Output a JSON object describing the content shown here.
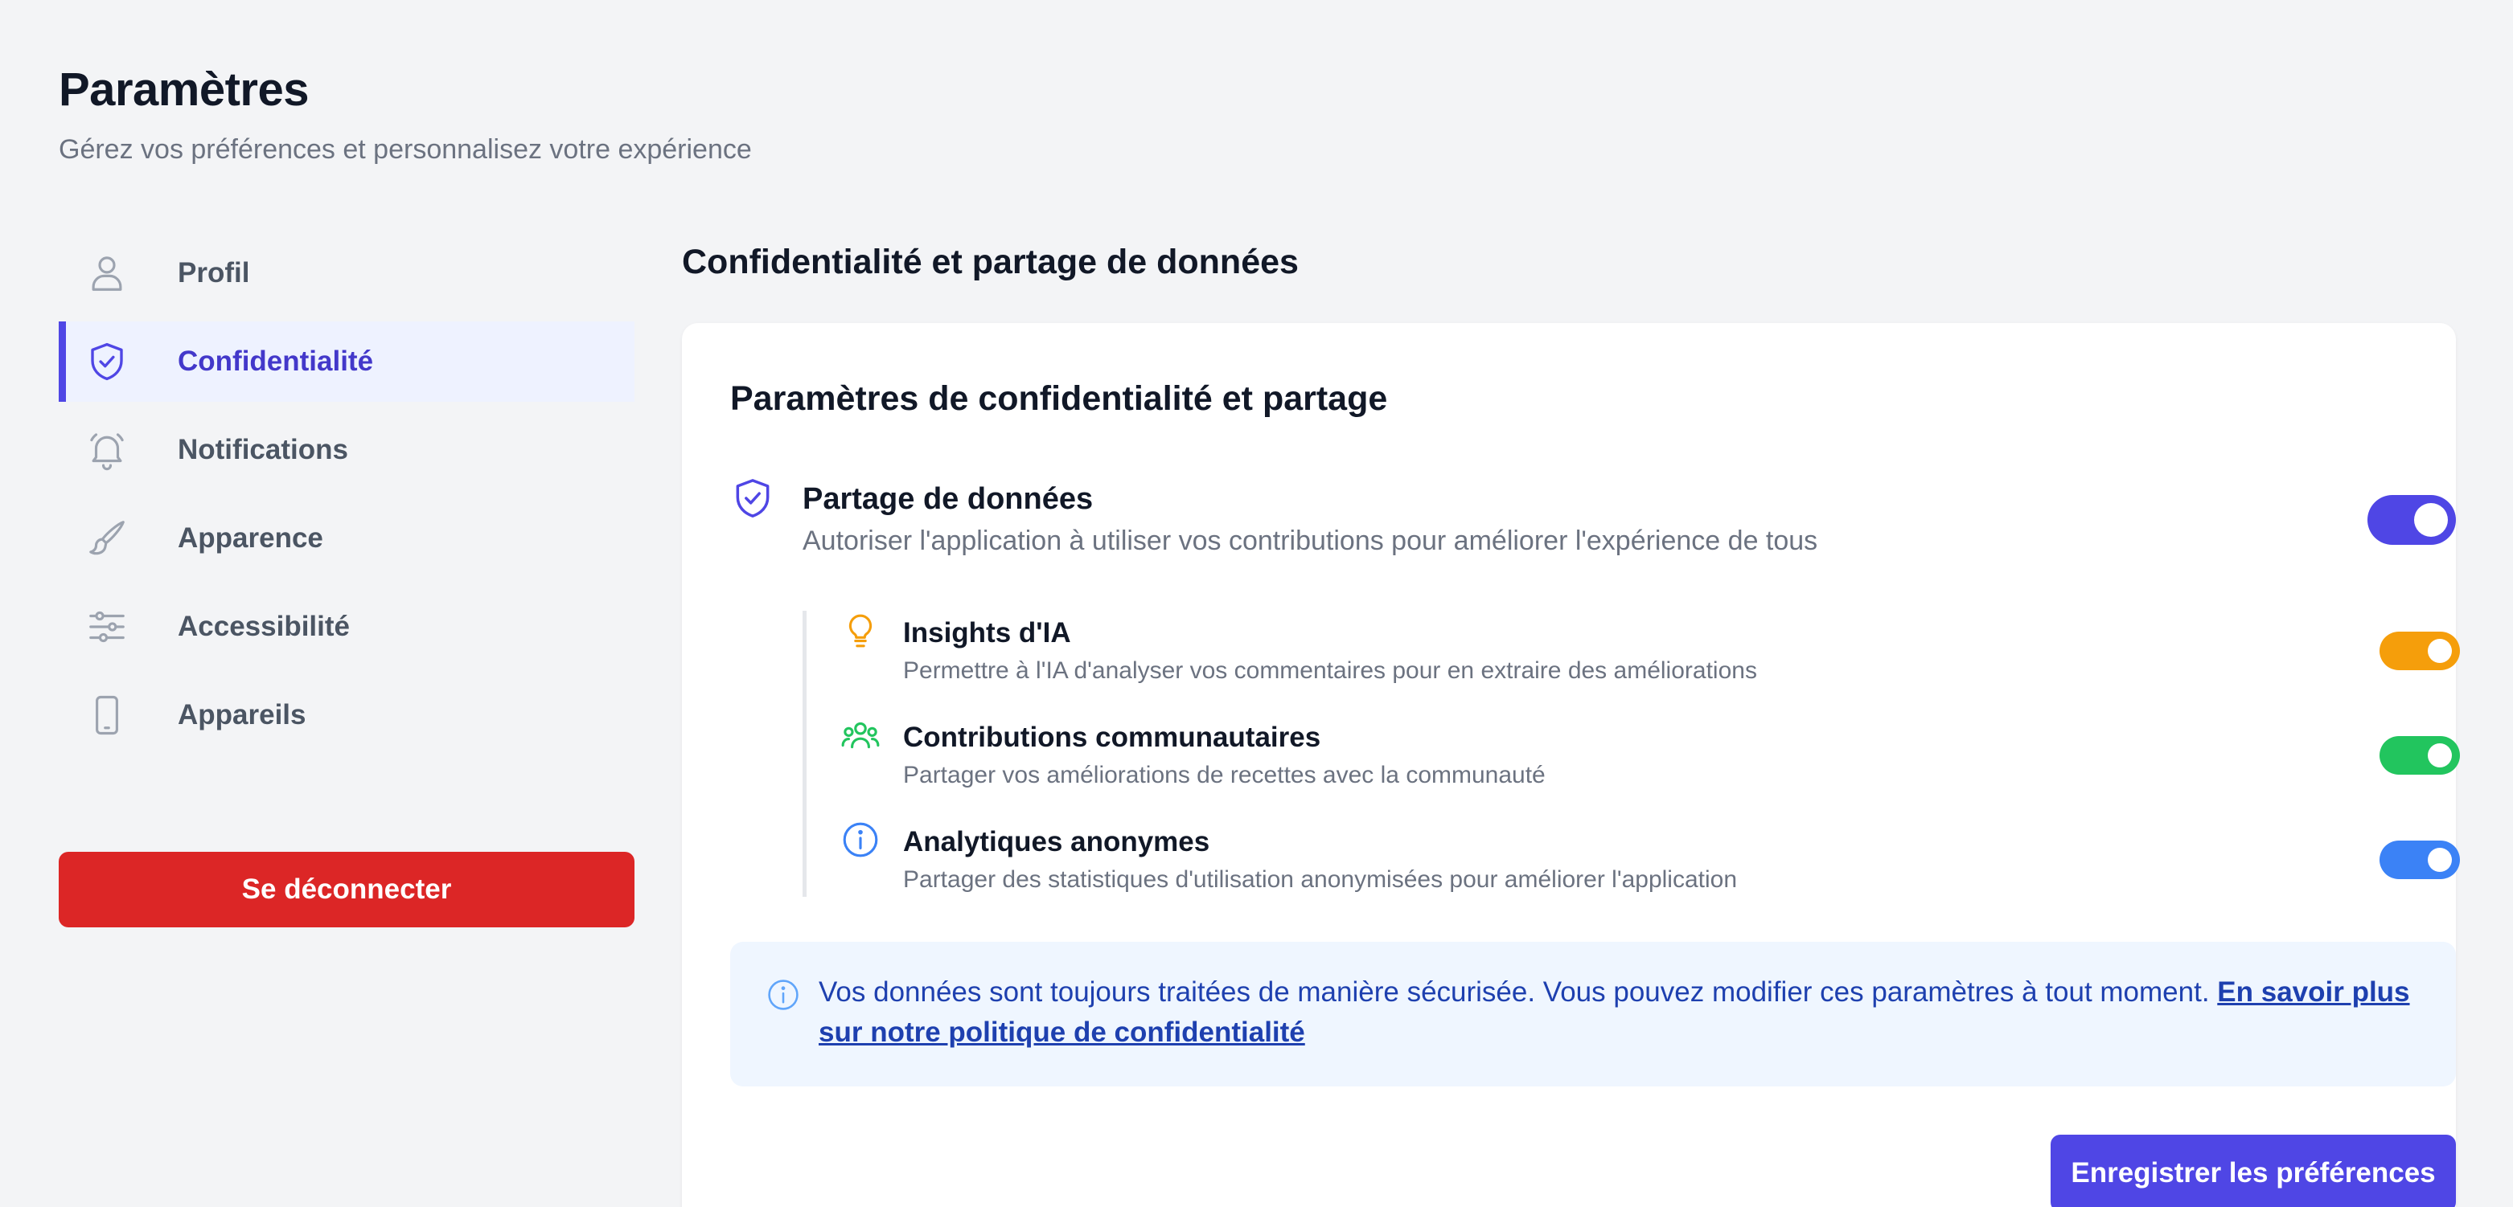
{
  "header": {
    "title": "Paramètres",
    "subtitle": "Gérez vos préférences et personnalisez votre expérience"
  },
  "sidebar": {
    "items": [
      {
        "label": "Profil",
        "icon": "user-icon",
        "active": false
      },
      {
        "label": "Confidentialité",
        "icon": "shield-check-icon",
        "active": true
      },
      {
        "label": "Notifications",
        "icon": "bell-icon",
        "active": false
      },
      {
        "label": "Apparence",
        "icon": "brush-icon",
        "active": false
      },
      {
        "label": "Accessibilité",
        "icon": "sliders-icon",
        "active": false
      },
      {
        "label": "Appareils",
        "icon": "phone-icon",
        "active": false
      }
    ],
    "logout_label": "Se déconnecter"
  },
  "main": {
    "section_title": "Confidentialité et partage de données",
    "card_title": "Paramètres de confidentialité et partage",
    "data_sharing": {
      "label": "Partage de données",
      "description": "Autoriser l'application à utiliser vos contributions pour améliorer l'expérience de tous",
      "enabled": true,
      "color": "#4f46e5"
    },
    "sub_settings": [
      {
        "label": "Insights d'IA",
        "description": "Permettre à l'IA d'analyser vos commentaires pour en extraire des améliorations",
        "icon": "lightbulb-icon",
        "enabled": true,
        "color": "#f59e0b"
      },
      {
        "label": "Contributions communautaires",
        "description": "Partager vos améliorations de recettes avec la communauté",
        "icon": "users-icon",
        "enabled": true,
        "color": "#22c55e"
      },
      {
        "label": "Analytiques anonymes",
        "description": "Partager des statistiques d'utilisation anonymisées pour améliorer l'application",
        "icon": "info-icon",
        "enabled": true,
        "color": "#3b82f6"
      }
    ],
    "info": {
      "text": "Vos données sont toujours traitées de manière sécurisée. Vous pouvez modifier ces paramètres à tout moment.",
      "link_label": "En savoir plus sur notre politique de confidentialité"
    },
    "save_label": "Enregistrer les préférences"
  },
  "colors": {
    "accent": "#4f46e5",
    "danger": "#dc2626",
    "background": "#f3f4f6"
  }
}
